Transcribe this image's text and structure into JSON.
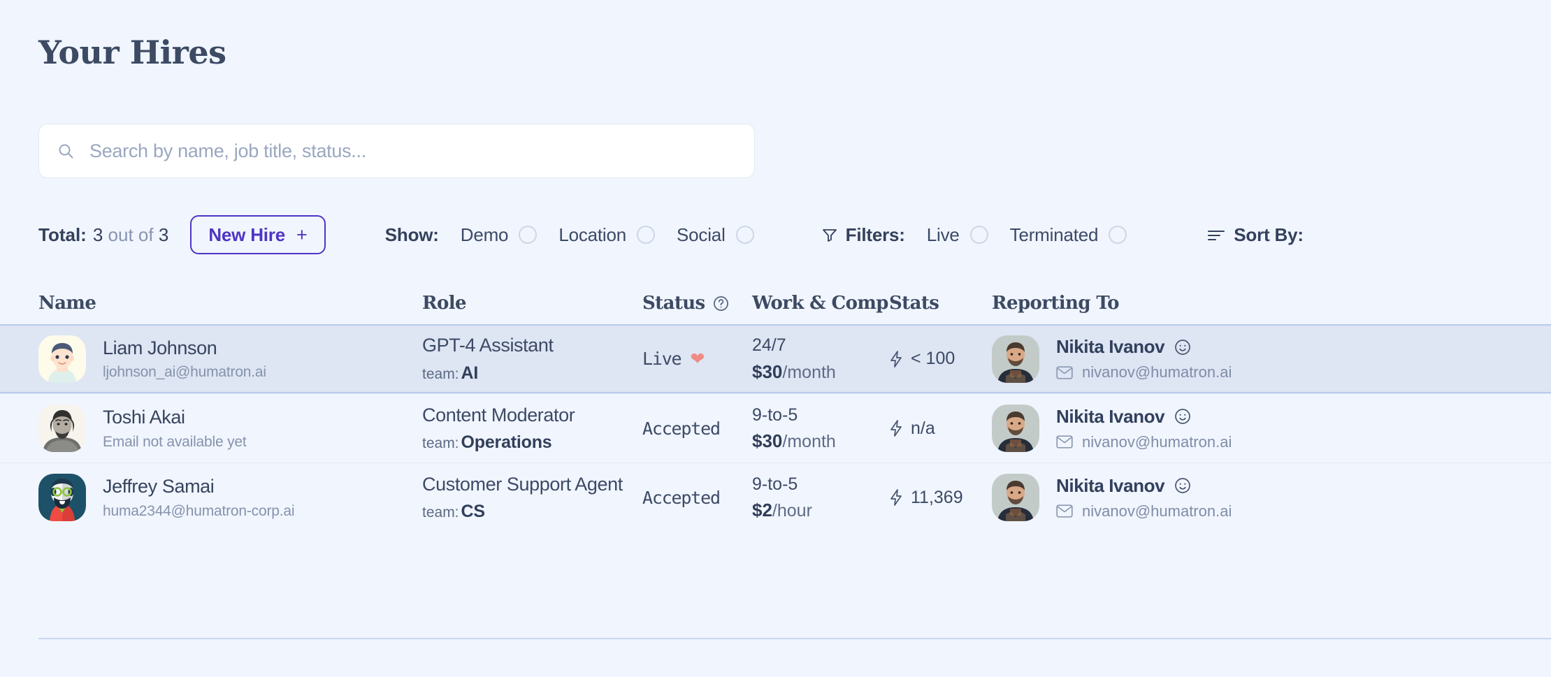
{
  "header": {
    "title": "Your Hires"
  },
  "search": {
    "placeholder": "Search by name, job title, status...",
    "value": "",
    "icon": "search-icon"
  },
  "toolbar": {
    "total_label": "Total:",
    "total_count": "3",
    "total_of": "out of",
    "total_max": "3",
    "new_hire_label": "New Hire",
    "new_hire_plus": "+",
    "show_label": "Show:",
    "show_options": [
      {
        "label": "Demo",
        "on": false
      },
      {
        "label": "Location",
        "on": false
      },
      {
        "label": "Social",
        "on": false
      }
    ],
    "filters_label": "Filters:",
    "filters_icon": "funnel-icon",
    "filter_options": [
      {
        "label": "Live",
        "on": false
      },
      {
        "label": "Terminated",
        "on": false
      }
    ],
    "sort_label": "Sort By:",
    "sort_icon": "sort-lines-icon"
  },
  "table": {
    "columns": [
      {
        "label": "Name"
      },
      {
        "label": "Role"
      },
      {
        "label": "Status",
        "icon": "help-circle-icon"
      },
      {
        "label": "Work & Comp"
      },
      {
        "label": "Stats"
      },
      {
        "label": "Reporting To"
      }
    ],
    "rows": [
      {
        "highlighted": true,
        "name": "Liam Johnson",
        "email": "ljohnson_ai@humatron.ai",
        "avatar": "cartoon-male-avatar",
        "role": "GPT-4 Assistant",
        "team_label": "team:",
        "team": "AI",
        "status": "Live",
        "status_icon": "heart-icon",
        "schedule": "24/7",
        "rate_amount": "$30",
        "rate_unit": "/month",
        "stats": "< 100",
        "stats_icon": "lightning-bolt-icon",
        "manager": "Nikita Ivanov",
        "manager_icon": "smiley-icon",
        "manager_email": "nivanov@humatron.ai",
        "manager_avatar": "photo-bearded-man"
      },
      {
        "highlighted": false,
        "name": "Toshi Akai",
        "email": "Email not available yet",
        "avatar": "sketch-male-avatar",
        "role": "Content Moderator",
        "team_label": "team:",
        "team": "Operations",
        "status": "Accepted",
        "status_icon": "",
        "schedule": "9-to-5",
        "rate_amount": "$30",
        "rate_unit": "/month",
        "stats": "n/a",
        "stats_icon": "lightning-bolt-icon",
        "manager": "Nikita Ivanov",
        "manager_icon": "smiley-icon",
        "manager_email": "nivanov@humatron.ai",
        "manager_avatar": "photo-bearded-man"
      },
      {
        "highlighted": false,
        "name": "Jeffrey Samai",
        "email": "huma2344@humatron-corp.ai",
        "avatar": "flat-bearded-glasses-avatar",
        "role": "Customer Support Agent",
        "team_label": "team:",
        "team": "CS",
        "status": "Accepted",
        "status_icon": "",
        "schedule": "9-to-5",
        "rate_amount": "$2",
        "rate_unit": "/hour",
        "stats": "11,369",
        "stats_icon": "lightning-bolt-icon",
        "manager": "Nikita Ivanov",
        "manager_icon": "smiley-icon",
        "manager_email": "nivanov@humatron.ai",
        "manager_avatar": "photo-bearded-man"
      }
    ]
  },
  "colors": {
    "page_background": "#f1f5fd",
    "accent_purple": "#4f35c4",
    "text_dark": "#33415c",
    "text_muted": "#8795b0",
    "row_highlight": "#dee5f3",
    "heart_red": "#ef8a85"
  }
}
